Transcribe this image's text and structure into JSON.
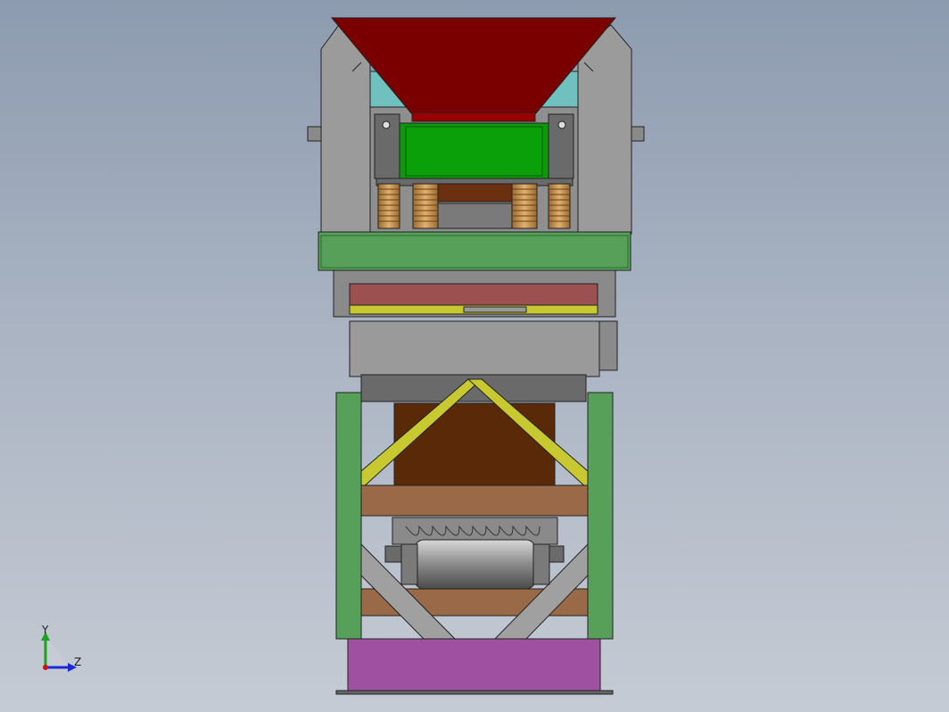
{
  "triad": {
    "y_label": "Y",
    "z_label": "Z",
    "colors": {
      "y_axis": "#1fa01f",
      "z_axis": "#1a2bd6",
      "origin": "#d01010"
    }
  },
  "model_colors": {
    "hopper": "#7a0000",
    "feeder_box": "#0c9a0c",
    "frame_green": "#56a05a",
    "tray_red": "#9c5050",
    "tray_yellow": "#c8c830",
    "brace_yellow": "#c8c830",
    "chute_brown": "#5a2a08",
    "beam_tan": "#9a6a48",
    "base_magenta": "#a050a0",
    "steel_gray": "#a0a0a0",
    "teal": "#70c0c0",
    "spring": "#c89858"
  }
}
